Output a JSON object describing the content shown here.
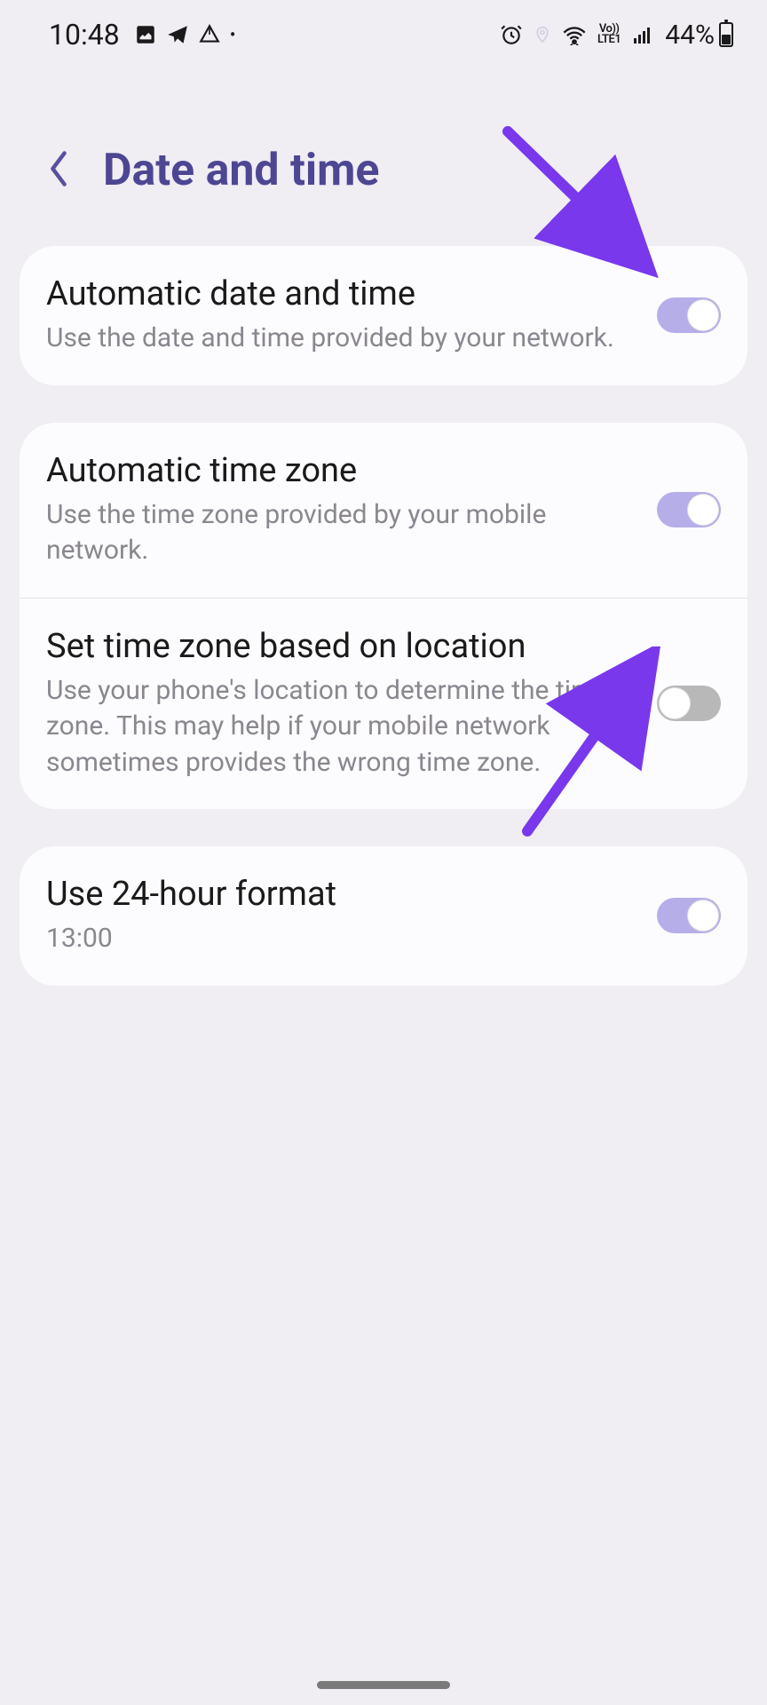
{
  "status": {
    "time": "10:48",
    "battery_percent": "44%",
    "lte_text": "Vo))\nLTE1"
  },
  "header": {
    "title": "Date and time"
  },
  "settings": {
    "auto_date": {
      "title": "Automatic date and time",
      "subtitle": "Use the date and time provided by your network.",
      "enabled": true
    },
    "auto_tz": {
      "title": "Automatic time zone",
      "subtitle": "Use the time zone provided by your mobile network.",
      "enabled": true
    },
    "location_tz": {
      "title": "Set time zone based on location",
      "subtitle": "Use your phone's location to determine the time zone. This may help if your mobile network sometimes provides the wrong time zone.",
      "enabled": false
    },
    "hour24": {
      "title": "Use 24-hour format",
      "subtitle": "13:00",
      "enabled": true
    }
  },
  "colors": {
    "accent": "#4d4692",
    "toggle_on": "#b5aee9",
    "toggle_off": "#b8b8b8",
    "annotation": "#7938ec"
  }
}
